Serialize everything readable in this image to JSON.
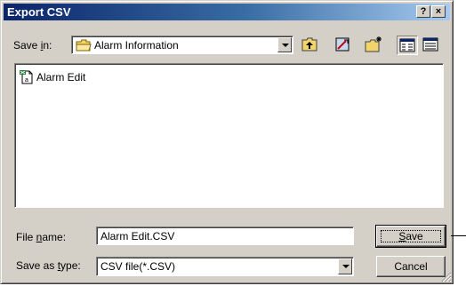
{
  "window": {
    "title": "Export CSV"
  },
  "titlebar": {
    "help_label": "?",
    "close_label": "×"
  },
  "toolbar": {
    "save_in_label_pre": "Save ",
    "save_in_label_key": "i",
    "save_in_label_post": "n:",
    "location": "Alarm Information",
    "icons": [
      "up-one-level-icon",
      "favorites-icon",
      "create-new-folder-icon",
      "list-view-icon",
      "details-view-icon"
    ]
  },
  "files": [
    {
      "name": "Alarm Edit",
      "icon": "file-icon"
    }
  ],
  "file_name": {
    "label_pre": "File ",
    "label_key": "n",
    "label_post": "ame:",
    "value": "Alarm Edit.CSV"
  },
  "save_as_type": {
    "label_pre": "Save as ",
    "label_key": "t",
    "label_post": "ype:",
    "value": "CSV file(*.CSV)"
  },
  "buttons": {
    "save_key": "S",
    "save_rest": "ave",
    "cancel": "Cancel"
  },
  "colors": {
    "title_start": "#0a246a",
    "title_end": "#a6caf0",
    "face": "#d4d0c8"
  }
}
